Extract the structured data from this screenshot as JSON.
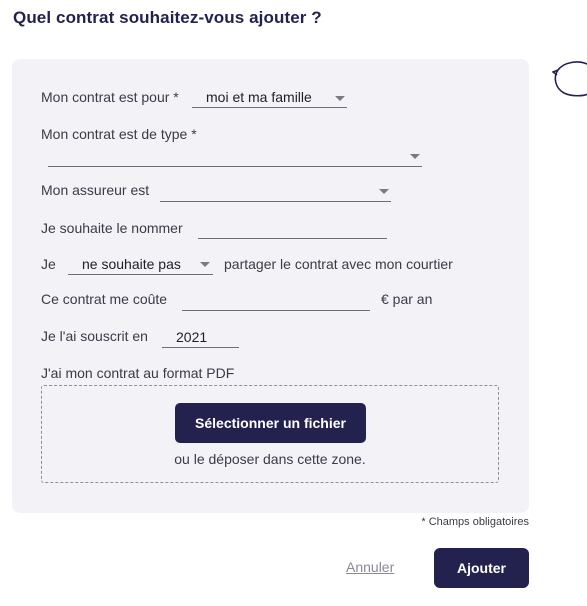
{
  "title": "Quel contrat souhaitez-vous ajouter ?",
  "form": {
    "for_label": "Mon contrat est pour *",
    "for_value": "moi et ma famille",
    "type_label": "Mon contrat est de type *",
    "type_value": "",
    "insurer_label": "Mon assureur est",
    "insurer_value": "",
    "name_label": "Je souhaite le nommer",
    "name_value": "",
    "share_prefix": "Je",
    "share_value": "ne souhaite pas",
    "share_suffix": "partager le contrat avec mon courtier",
    "cost_label": "Ce contrat me coûte",
    "cost_value": "",
    "cost_suffix": "€ par an",
    "subscribed_label": "Je l'ai souscrit en",
    "subscribed_value": "2021",
    "pdf_label": "J'ai mon contrat au format PDF"
  },
  "dropzone": {
    "button_label": "Sélectionner un fichier",
    "hint": "ou le déposer dans cette zone."
  },
  "required_note": "* Champs obligatoires",
  "actions": {
    "cancel_label": "Annuler",
    "add_label": "Ajouter"
  },
  "colors": {
    "primary": "#23224f",
    "panel": "#f2f2f7"
  },
  "icons": {
    "chat": "chat-bubble-icon",
    "dropdown": "chevron-down-icon"
  }
}
